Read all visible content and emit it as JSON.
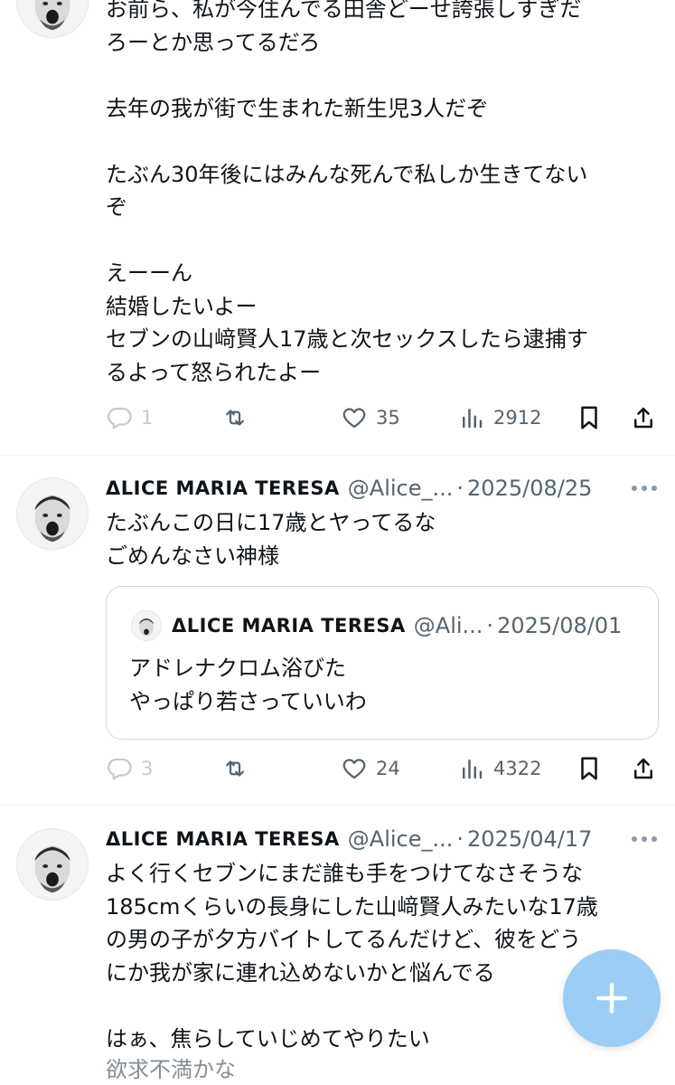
{
  "colors": {
    "text": "#0f1419",
    "secondary": "#536471",
    "accent": "#1d9bf0",
    "fab": "#9ccdf4",
    "divider": "#eff3f4"
  },
  "tweet1": {
    "avatar": "avatar-face",
    "lines": [
      "お前ら、私が今住んでる田舎どーせ誇張しすぎだ",
      "ろーとか思ってるだろ",
      "",
      "去年の我が街で生まれた新生児3人だぞ",
      "",
      "たぶん30年後にはみんな死んで私しか生きてない",
      "ぞ",
      "",
      "えーーん",
      "結婚したいよー",
      "セブンの山﨑賢人17歳と次セックスしたら逮捕す",
      "るよって怒られたよー"
    ],
    "actions": {
      "replies": "1",
      "reposts": "",
      "likes": "35",
      "views": "2912"
    }
  },
  "tweet2": {
    "display_name": "ΔLICE MARIA TERESA",
    "handle": "@Alice_...",
    "dot": "·",
    "date": "2025/08/25",
    "lines": [
      "たぶんこの日に17歳とヤってるな",
      "ごめんなさい神様"
    ],
    "quote": {
      "display_name": "ΔLICE MARIA TERESA",
      "handle": "@Ali...",
      "dot": "·",
      "date": "2025/08/01",
      "lines": [
        "アドレナクロム浴びた",
        "やっぱり若さっていいわ"
      ]
    },
    "actions": {
      "replies": "3",
      "reposts": "",
      "likes": "24",
      "views": "4322"
    }
  },
  "tweet3": {
    "display_name": "ΔLICE MARIA TERESA",
    "handle": "@Alice_...",
    "dot": "·",
    "date": "2025/04/17",
    "lines": [
      "よく行くセブンにまだ誰も手をつけてなさそうな",
      "185cmくらいの長身にした山﨑賢人みたいな17歳",
      "の男の子が夕方バイトしてるんだけど、彼をどう",
      "にか我が家に連れ込めないかと悩んでる",
      "",
      "はぁ、焦らしていじめてやりたい"
    ],
    "cut_off_line": "欲求不満かな"
  },
  "icons": {
    "reply": "reply-icon",
    "repost": "repost-icon",
    "like": "heart-icon",
    "views": "views-icon",
    "bookmark": "bookmark-icon",
    "share": "share-icon",
    "more": "more-icon",
    "compose": "plus-icon"
  }
}
